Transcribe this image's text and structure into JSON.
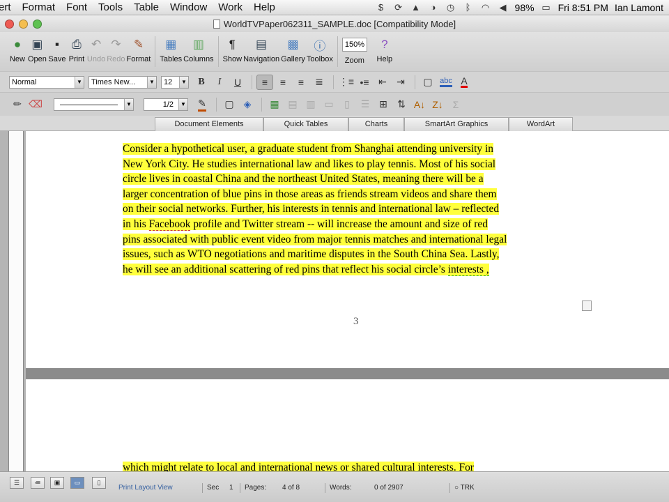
{
  "menubar": {
    "items": [
      "ert",
      "Format",
      "Font",
      "Tools",
      "Table",
      "Window",
      "Work",
      "Help"
    ],
    "battery": "98%",
    "clock": "Fri 8:51 PM",
    "user": "Ian Lamont"
  },
  "window": {
    "title": "WorldTVPaper062311_SAMPLE.doc [Compatibility Mode]"
  },
  "toolbar": {
    "new": "New",
    "open": "Open",
    "save": "Save",
    "print": "Print",
    "undo": "Undo",
    "redo": "Redo",
    "format": "Format",
    "tables": "Tables",
    "columns": "Columns",
    "show": "Show",
    "navigation": "Navigation",
    "gallery": "Gallery",
    "toolbox": "Toolbox",
    "zoom_value": "150%",
    "zoom": "Zoom",
    "help": "Help"
  },
  "formatting": {
    "style": "Normal",
    "font": "Times New...",
    "size": "12",
    "bold": "B",
    "italic": "I",
    "underline": "U"
  },
  "drawing": {
    "line_weight": "1/2"
  },
  "gallery_tabs": [
    "Document Elements",
    "Quick Tables",
    "Charts",
    "SmartArt Graphics",
    "WordArt"
  ],
  "document": {
    "page3_lines": [
      "Consider a hypothetical user, a graduate student from Shanghai attending university in",
      "New York City. He studies international law and likes to play tennis. Most of his social",
      "circle lives in coastal China and the northeast United States, meaning there will be a",
      "larger concentration of blue pins in those areas as friends stream videos and share them",
      "on their social networks. Further, his interests in tennis and international law – reflected",
      "in his ",
      "Facebook",
      " profile and Twitter stream -- will increase the amount and size of red",
      "pins associated with public event video from major tennis matches and international legal",
      "issues, such as WTO negotiations and maritime disputes in the South China Sea. Lastly,",
      "he will see an additional scattering of red pins that reflect his social circle’s ",
      "interests ,"
    ],
    "page_number": "3",
    "page4_line": "which might relate to local and international news or shared cultural interests. For"
  },
  "statusbar": {
    "view": "Print Layout View",
    "sec_label": "Sec",
    "sec": "1",
    "pages_label": "Pages:",
    "pages": "4 of 8",
    "words_label": "Words:",
    "words": "0 of 2907",
    "trk": "TRK"
  },
  "colors": {
    "highlight": "#ffff3c",
    "font_color": "#e00000"
  }
}
